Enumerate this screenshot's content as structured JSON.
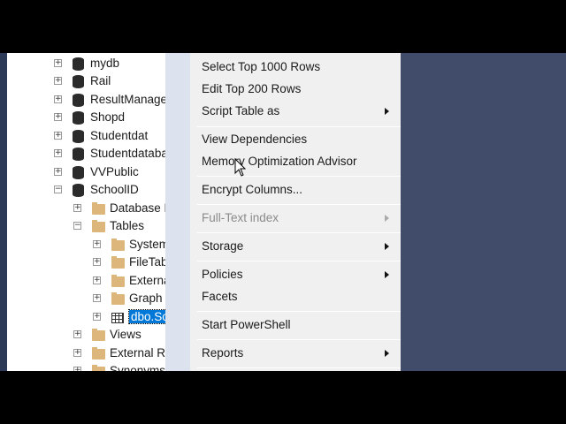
{
  "tree": {
    "databases": [
      "mydb",
      "Rail",
      "ResultManage",
      "Shopd",
      "Studentdat",
      "Studentdataba",
      "VVPublic",
      "SchoolID"
    ],
    "schoolid_children": [
      "Database D",
      "Tables"
    ],
    "tables_children": [
      "System",
      "FileTab",
      "Externa",
      "Graph T"
    ],
    "selected_table": "dbo.Sc",
    "after": [
      "Views",
      "External Re",
      "Synonyms"
    ]
  },
  "menu": {
    "items": [
      {
        "label": "Select Top 1000 Rows"
      },
      {
        "label": "Edit Top 200 Rows"
      },
      {
        "label": "Script Table as",
        "submenu": true
      },
      {
        "label": "View Dependencies"
      },
      {
        "label": "Memory Optimization Advisor"
      },
      {
        "label": "Encrypt Columns..."
      },
      {
        "label": "Full-Text index",
        "submenu": true,
        "disabled": true
      },
      {
        "label": "Storage",
        "submenu": true
      },
      {
        "label": "Policies",
        "submenu": true
      },
      {
        "label": "Facets"
      },
      {
        "label": "Start PowerShell"
      },
      {
        "label": "Reports",
        "submenu": true
      }
    ]
  }
}
